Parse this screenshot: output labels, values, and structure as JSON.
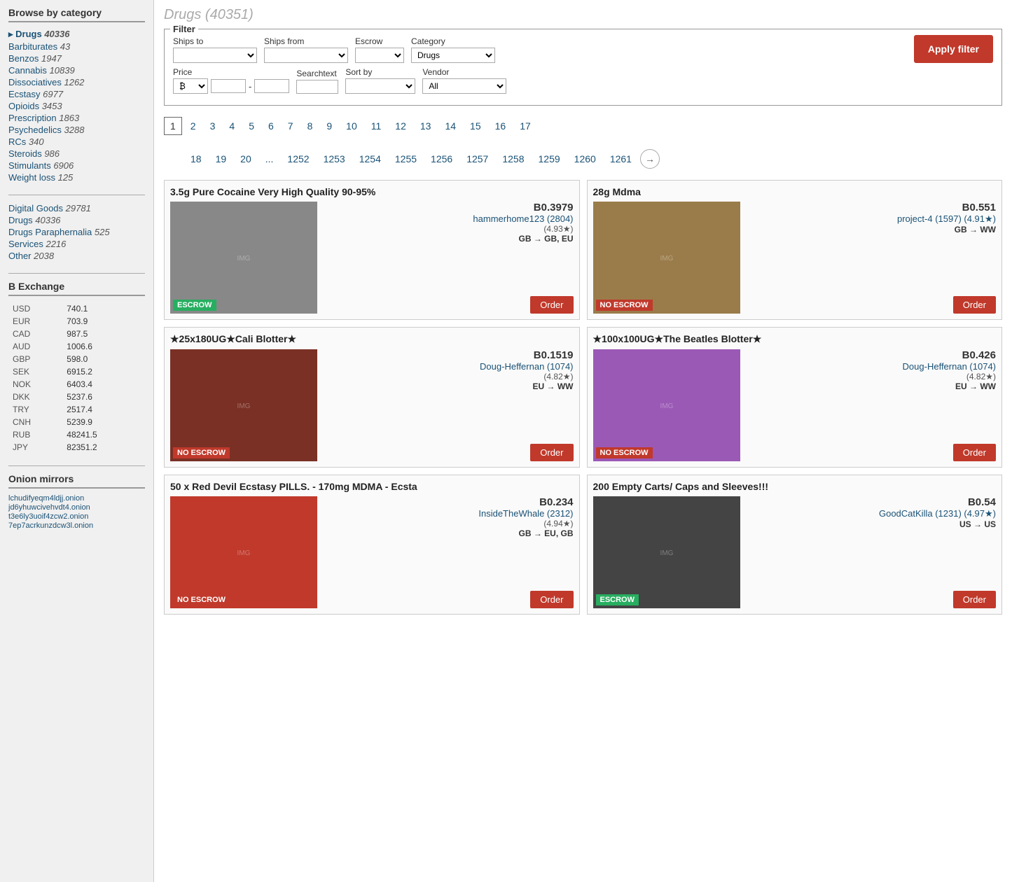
{
  "sidebar": {
    "browse_title": "Browse by category",
    "categories_main": [
      {
        "label": "Drugs",
        "count": "40336",
        "active": true,
        "indent": false
      },
      {
        "label": "Barbiturates",
        "count": "43",
        "active": false,
        "indent": true
      },
      {
        "label": "Benzos",
        "count": "1947",
        "active": false,
        "indent": true
      },
      {
        "label": "Cannabis",
        "count": "10839",
        "active": false,
        "indent": true
      },
      {
        "label": "Dissociatives",
        "count": "1262",
        "active": false,
        "indent": true
      },
      {
        "label": "Ecstasy",
        "count": "6977",
        "active": false,
        "indent": true
      },
      {
        "label": "Opioids",
        "count": "3453",
        "active": false,
        "indent": true
      },
      {
        "label": "Prescription",
        "count": "1863",
        "active": false,
        "indent": true
      },
      {
        "label": "Psychedelics",
        "count": "3288",
        "active": false,
        "indent": true
      },
      {
        "label": "RCs",
        "count": "340",
        "active": false,
        "indent": true
      },
      {
        "label": "Steroids",
        "count": "986",
        "active": false,
        "indent": true
      },
      {
        "label": "Stimulants",
        "count": "6906",
        "active": false,
        "indent": true
      },
      {
        "label": "Weight loss",
        "count": "125",
        "active": false,
        "indent": true
      }
    ],
    "categories_secondary": [
      {
        "label": "Digital Goods",
        "count": "29781"
      },
      {
        "label": "Drugs",
        "count": "40336"
      },
      {
        "label": "Drugs Paraphernalia",
        "count": "525"
      },
      {
        "label": "Services",
        "count": "2216"
      },
      {
        "label": "Other",
        "count": "2038"
      }
    ],
    "exchange_title": "B Exchange",
    "exchange": [
      {
        "currency": "USD",
        "value": "740.1"
      },
      {
        "currency": "EUR",
        "value": "703.9"
      },
      {
        "currency": "CAD",
        "value": "987.5"
      },
      {
        "currency": "AUD",
        "value": "1006.6"
      },
      {
        "currency": "GBP",
        "value": "598.0"
      },
      {
        "currency": "SEK",
        "value": "6915.2"
      },
      {
        "currency": "NOK",
        "value": "6403.4"
      },
      {
        "currency": "DKK",
        "value": "5237.6"
      },
      {
        "currency": "TRY",
        "value": "2517.4"
      },
      {
        "currency": "CNH",
        "value": "5239.9"
      },
      {
        "currency": "RUB",
        "value": "48241.5"
      },
      {
        "currency": "JPY",
        "value": "82351.2"
      }
    ],
    "onion_title": "Onion mirrors",
    "onion_links": [
      "lchudifyeqm4ldjj.onion",
      "jd6yhuwcivehvdt4.onion",
      "t3e6ly3uoif4zcw2.onion",
      "7ep7acrkunzdcw3l.onion"
    ]
  },
  "main": {
    "page_title": "Drugs (40351)",
    "filter": {
      "legend": "Filter",
      "ships_to_label": "Ships to",
      "ships_from_label": "Ships from",
      "escrow_label": "Escrow",
      "category_label": "Category",
      "category_value": "Drugs",
      "price_label": "Price",
      "searchtext_label": "Searchtext",
      "sort_by_label": "Sort by",
      "vendor_label": "Vendor",
      "vendor_value": "All",
      "apply_button": "Apply filter"
    },
    "pagination": {
      "pages_row1": [
        "1",
        "2",
        "3",
        "4",
        "5",
        "6",
        "7",
        "8",
        "9",
        "10",
        "11",
        "12",
        "13",
        "14",
        "15",
        "16",
        "17"
      ],
      "pages_row2": [
        "18",
        "19",
        "20",
        "...",
        "1252",
        "1253",
        "1254",
        "1255",
        "1256",
        "1257",
        "1258",
        "1259",
        "1260",
        "1261"
      ]
    },
    "products": [
      {
        "title": "3.5g Pure Cocaine Very High Quality 90-95%",
        "price": "B0.3979",
        "vendor": "hammerhome123 (2804)",
        "rating": "(4.93★)",
        "shipping": "GB → GB, EU",
        "escrow": "ESCROW",
        "escrow_type": "green",
        "has_image": true,
        "img_bg": "#888"
      },
      {
        "title": "28g Mdma",
        "price": "B0.551",
        "vendor": "project-4 (1597) (4.91★)",
        "rating": "",
        "shipping": "GB → WW",
        "escrow": "NO ESCROW",
        "escrow_type": "red",
        "has_image": true,
        "img_bg": "#b8860b"
      },
      {
        "title": "★25x180UG★Cali Blotter★",
        "price": "B0.1519",
        "vendor": "Doug-Heffernan (1074)",
        "rating": "(4.82★)",
        "shipping": "EU → WW",
        "escrow": "NO ESCROW",
        "escrow_type": "red",
        "has_image": true,
        "img_bg": "#c0392b"
      },
      {
        "title": "★100x100UG★The Beatles Blotter★",
        "price": "B0.426",
        "vendor": "Doug-Heffernan (1074)",
        "rating": "(4.82★)",
        "shipping": "EU → WW",
        "escrow": "NO ESCROW",
        "escrow_type": "red",
        "has_image": true,
        "img_bg": "#8e44ad"
      },
      {
        "title": "50 x Red Devil Ecstasy PILLS. - 170mg MDMA - Ecsta",
        "price": "B0.234",
        "vendor": "InsideTheWhale (2312)",
        "rating": "(4.94★)",
        "shipping": "GB → EU, GB",
        "escrow": "NO ESCROW",
        "escrow_type": "red",
        "has_image": true,
        "img_bg": "#c0392b"
      },
      {
        "title": "200 Empty Carts/ Caps and Sleeves!!!",
        "price": "B0.54",
        "vendor": "GoodCatKilla (1231) (4.97★)",
        "rating": "",
        "shipping": "US → US",
        "escrow": "ESCROW",
        "escrow_type": "green",
        "has_image": true,
        "img_bg": "#555"
      }
    ]
  }
}
